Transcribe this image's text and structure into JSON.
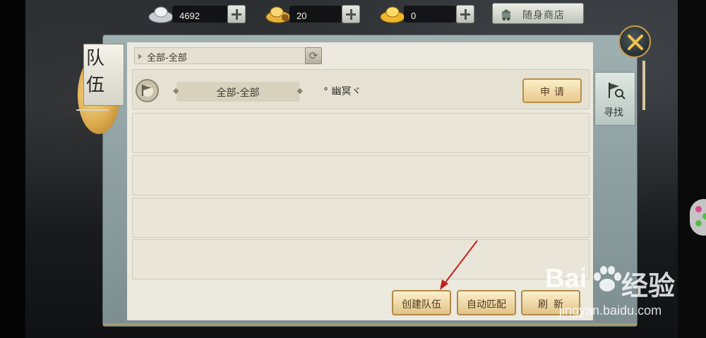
{
  "currencies": [
    {
      "name": "silver",
      "value": "4692",
      "icon": "silver-ingot-icon"
    },
    {
      "name": "bound-gold",
      "value": "20",
      "icon": "bound-gold-ingot-icon"
    },
    {
      "name": "gold",
      "value": "0",
      "icon": "gold-ingot-icon"
    }
  ],
  "shop": {
    "label": "随身商店",
    "icon": "shop-icon"
  },
  "title": {
    "char1": "队",
    "char2": "伍"
  },
  "filter": {
    "label": "全部-全部"
  },
  "side_tab": {
    "label": "寻找",
    "icon": "search-flag-icon"
  },
  "teams": [
    {
      "zone": "全部-全部",
      "leader": "° 幽冥ヾ",
      "apply_label": "申请"
    }
  ],
  "buttons": {
    "create": "创建队伍",
    "auto_match": "自动匹配",
    "refresh": "刷新"
  },
  "watermark": {
    "brand_left": "Bai",
    "brand_right": "经验",
    "url": "jingyan.baidu.com"
  },
  "colors": {
    "accent_gold": "#e2c488",
    "panel_bg": "#ece9de",
    "frame": "#8a9b9d",
    "annotation": "#c0221f"
  }
}
